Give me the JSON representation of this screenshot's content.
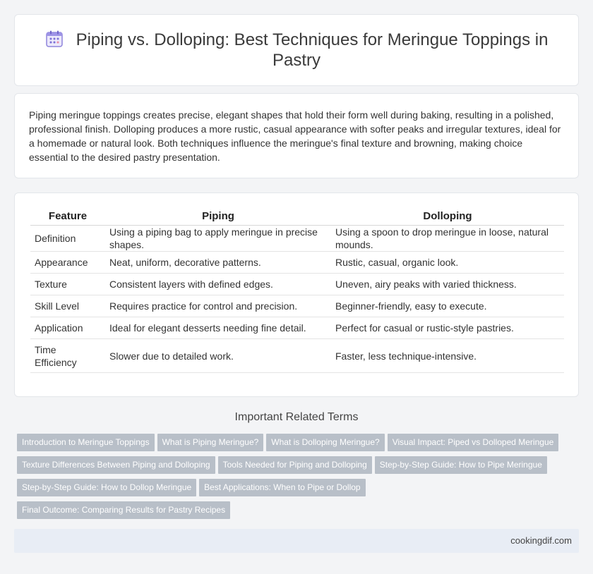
{
  "title": "Piping vs. Dolloping: Best Techniques for Meringue Toppings in Pastry",
  "title_icon": "calendar-icon",
  "intro": "Piping meringue toppings creates precise, elegant shapes that hold their form well during baking, resulting in a polished, professional finish. Dolloping produces a more rustic, casual appearance with softer peaks and irregular textures, ideal for a homemade or natural look. Both techniques influence the meringue's final texture and browning, making choice essential to the desired pastry presentation.",
  "table": {
    "headers": [
      "Feature",
      "Piping",
      "Dolloping"
    ],
    "rows": [
      [
        "Definition",
        "Using a piping bag to apply meringue in precise shapes.",
        "Using a spoon to drop meringue in loose, natural mounds."
      ],
      [
        "Appearance",
        "Neat, uniform, decorative patterns.",
        "Rustic, casual, organic look."
      ],
      [
        "Texture",
        "Consistent layers with defined edges.",
        "Uneven, airy peaks with varied thickness."
      ],
      [
        "Skill Level",
        "Requires practice for control and precision.",
        "Beginner-friendly, easy to execute."
      ],
      [
        "Application",
        "Ideal for elegant desserts needing fine detail.",
        "Perfect for casual or rustic-style pastries."
      ],
      [
        "Time Efficiency",
        "Slower due to detailed work.",
        "Faster, less technique-intensive."
      ]
    ]
  },
  "related": {
    "heading": "Important Related Terms",
    "tags": [
      "Introduction to Meringue Toppings",
      "What is Piping Meringue?",
      "What is Dolloping Meringue?",
      "Visual Impact: Piped vs Dolloped Meringue",
      "Texture Differences Between Piping and Dolloping",
      "Tools Needed for Piping and Dolloping",
      "Step-by-Step Guide: How to Pipe Meringue",
      "Step-by-Step Guide: How to Dollop Meringue",
      "Best Applications: When to Pipe or Dollop",
      "Final Outcome: Comparing Results for Pastry Recipes"
    ]
  },
  "footer": {
    "site": "cookingdif.com"
  },
  "colors": {
    "tag_bg": "#b8bfc8",
    "footer_bg": "#e8edf5",
    "icon_accent": "#7b6fd6"
  }
}
